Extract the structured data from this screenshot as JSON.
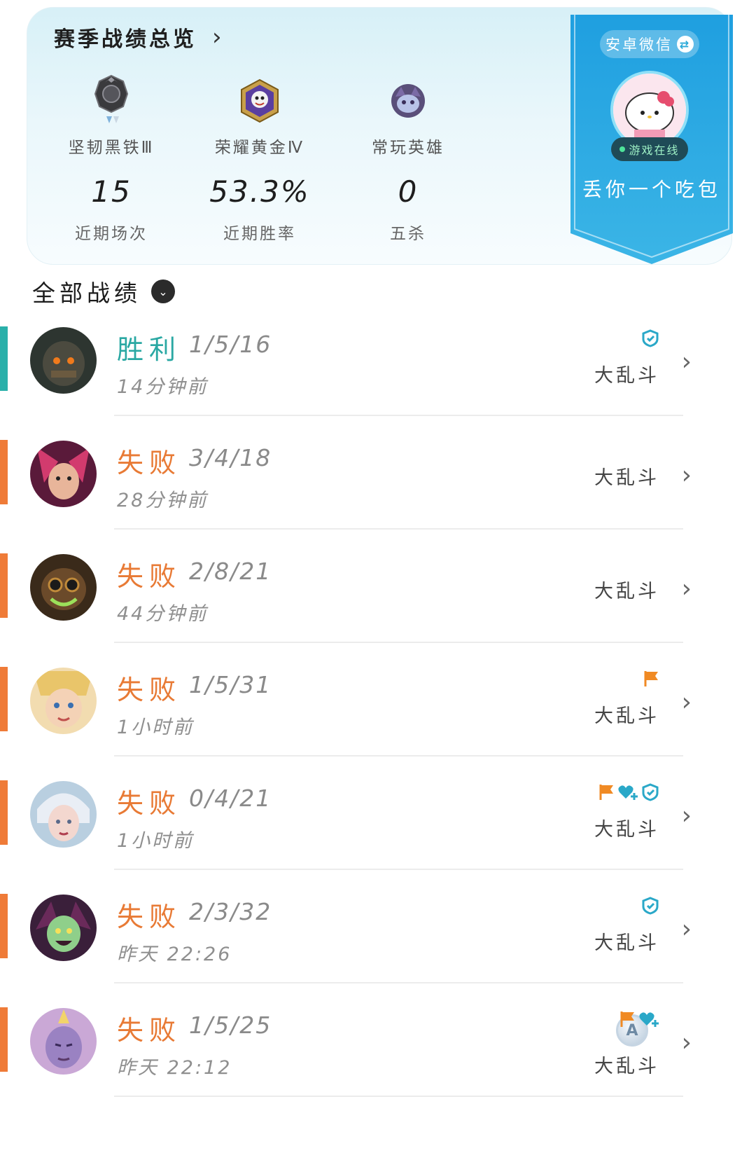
{
  "summary": {
    "title": "赛季战绩总览",
    "chevron": "›",
    "columns": [
      {
        "top_label": "坚韧黑铁Ⅲ",
        "value": "15",
        "bottom_label": "近期场次",
        "badge_icon": "iron-rank-icon"
      },
      {
        "top_label": "荣耀黄金Ⅳ",
        "value": "53.3%",
        "bottom_label": "近期胜率",
        "badge_icon": "gold-rank-icon"
      },
      {
        "top_label": "常玩英雄",
        "value": "0",
        "bottom_label": "五杀",
        "badge_icon": "hero-icon"
      }
    ]
  },
  "profile": {
    "platform": "安卓微信",
    "swap_symbol": "⇄",
    "online_status": "游戏在线",
    "nickname": "丢你一个吃包"
  },
  "section": {
    "title": "全部战绩",
    "dropdown_symbol": "⌄"
  },
  "matches": [
    {
      "result": "胜利",
      "kda": "1/5/16",
      "time": "14分钟前",
      "mode": "大乱斗",
      "outcome": "win"
    },
    {
      "result": "失败",
      "kda": "3/4/18",
      "time": "28分钟前",
      "mode": "大乱斗",
      "outcome": "lose"
    },
    {
      "result": "失败",
      "kda": "2/8/21",
      "time": "44分钟前",
      "mode": "大乱斗",
      "outcome": "lose"
    },
    {
      "result": "失败",
      "kda": "1/5/31",
      "time": "1小时前",
      "mode": "大乱斗",
      "outcome": "lose"
    },
    {
      "result": "失败",
      "kda": "0/4/21",
      "time": "1小时前",
      "mode": "大乱斗",
      "outcome": "lose"
    },
    {
      "result": "失败",
      "kda": "2/3/32",
      "time": "昨天 22:26",
      "mode": "大乱斗",
      "outcome": "lose"
    },
    {
      "result": "失败",
      "kda": "1/5/25",
      "time": "昨天 22:12",
      "mode": "大乱斗",
      "outcome": "lose"
    }
  ],
  "colors": {
    "win": "#2aa8a3",
    "lose": "#e87a35",
    "ribbon": "#2aa6dc"
  },
  "row_chevron": "›"
}
